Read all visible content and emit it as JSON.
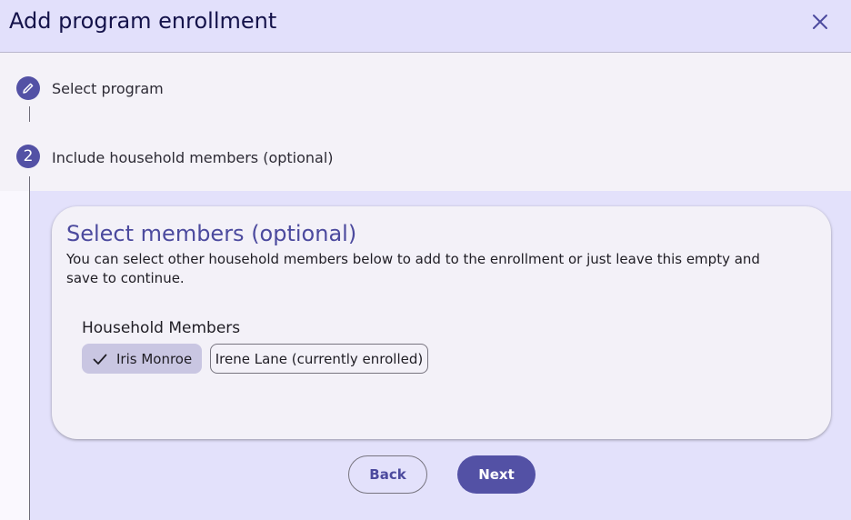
{
  "dialog": {
    "title": "Add program enrollment",
    "close_icon": "close-icon"
  },
  "steps": [
    {
      "indicator": "edit-pencil-icon",
      "label": "Select program"
    },
    {
      "indicator": "2",
      "label": "Include household members (optional)"
    }
  ],
  "card": {
    "title": "Select members (optional)",
    "description": "You can select other household members below to add to the enrollment or just leave this empty and save to continue.",
    "members_label": "Household Members",
    "members": [
      {
        "name": "Iris Monroe",
        "selected": true
      },
      {
        "name": "Irene Lane (currently enrolled)",
        "selected": false
      }
    ]
  },
  "actions": {
    "back_label": "Back",
    "next_label": "Next"
  },
  "colors": {
    "accent": "#5351a5",
    "header_bg": "#e2e0fb",
    "selected_chip": "#c9c6e2"
  }
}
